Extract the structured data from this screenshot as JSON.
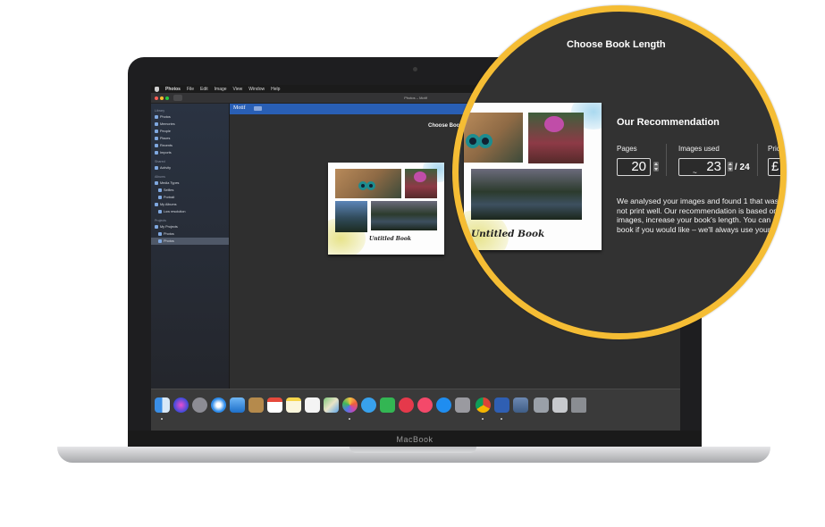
{
  "menubar": {
    "items": [
      "Photos",
      "File",
      "Edit",
      "Image",
      "View",
      "Window",
      "Help"
    ]
  },
  "window": {
    "title": "Photos – Motif"
  },
  "sidebar": {
    "library_heading": "Library",
    "library": [
      "Photos",
      "Memories",
      "People",
      "Places",
      "Recents",
      "Imports"
    ],
    "shared_heading": "Shared",
    "shared": [
      "Activity"
    ],
    "albums_heading": "Albums",
    "media_types": "Media Types",
    "media_children": [
      "Selfies",
      "Portrait"
    ],
    "my_albums": "My Albums",
    "my_albums_children": [
      "Low resolution"
    ],
    "projects_heading": "Projects",
    "my_projects": "My Projects",
    "projects_children": [
      "Photos",
      "Photos"
    ]
  },
  "main": {
    "motif_label": "Motif",
    "heading": "Choose Book",
    "small_text": "W\nnc\nim\nbo",
    "book_title": "Untitled Book"
  },
  "zoom": {
    "heading": "Choose Book Length",
    "recommendation_heading": "Our Recommendation",
    "pages_label": "Pages",
    "pages_value": "20",
    "images_label": "Images used",
    "approx": "~",
    "images_value": "23",
    "images_total": "/ 24",
    "price_label": "Pric",
    "price_value": "£",
    "book_title": "Untitled Book",
    "body_lines": [
      "We analysed your images and found 1 that was a",
      "not print well. Our recommendation is based on",
      "images, increase your book's length. You can al",
      "book if you would like – we'll always use your b"
    ]
  },
  "laptop": {
    "brand": "MacBook"
  },
  "colors": {
    "accent_ring": "#f5bd34",
    "motif_bar": "#295fb5",
    "screen_bg": "#2f2f2f"
  },
  "dock": {
    "icons": [
      "finder-icon",
      "siri-icon",
      "launchpad-icon",
      "safari-icon",
      "mail-icon",
      "contacts-icon",
      "calendar-icon",
      "notes-icon",
      "reminders-icon",
      "maps-icon",
      "photos-icon",
      "messages-icon",
      "facetime-icon",
      "news-icon",
      "music-icon",
      "app-store-icon",
      "system-preferences-icon",
      "chrome-icon",
      "motif-icon",
      "preview-icon",
      "folder-icon",
      "downloads-icon",
      "trash-icon"
    ]
  }
}
